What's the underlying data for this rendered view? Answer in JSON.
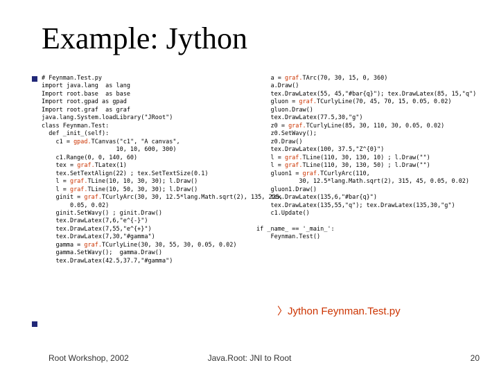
{
  "title": "Example: Jython",
  "code_left": "# Feynman.Test.py\nimport java.lang  as lang\nImport root.base  as base\nImport root.gpad as gpad\nImport root.graf  as graf\njava.lang.System.loadLibrary(\"JRoot\")\nclass Feynman.Test:\n  def _init_(self):\n    c1 = gpad.TCanvas(\"c1\", \"A canvas\",\n                     10, 10, 600, 300)\n    c1.Range(0, 0, 140, 60)\n    tex = graf.TLatex(1)\n    tex.SetTextAlign(22) ; tex.SetTextSize(0.1)\n    l = graf.TLine(10, 10, 30, 30); l.Draw()\n    l = graf.TLine(10, 50, 30, 30); l.Draw()\n    ginit = graf.TCurlyArc(30, 30, 12.5*lang.Math.sqrt(2), 135, 225,\n        0.05, 0.02)\n    ginit.SetWavy() ; ginit.Draw()\n    tex.DrawLatex(7,6,\"e^{-}\")\n    tex.DrawLatex(7,55,\"e^{+}\")\n    tex.DrawLatex(7,30,\"#gamma\")\n    gamma = graf.TCurlyLine(30, 30, 55, 30, 0.05, 0.02)\n    gamma.SetWavy();  gamma.Draw()\n    tex.DrawLatex(42.5,37.7,\"#gamma\")",
  "code_right": "    a = graf.TArc(70, 30, 15, 0, 360)\n    a.Draw()\n    tex.DrawLatex(55, 45,\"#bar{q}\"); tex.DrawLatex(85, 15,\"q\")\n    gluon = graf.TCurlyLine(70, 45, 70, 15, 0.05, 0.02)\n    gluon.Draw()\n    tex.DrawLatex(77.5,30,\"g\")\n    z0 = graf.TCurlyLine(85, 30, 110, 30, 0.05, 0.02)\n    z0.SetWavy();\n    z0.Draw()\n    tex.DrawLatex(100, 37.5,\"Z^{0}\")\n    l = graf.TLine(110, 30, 130, 10) ; l.Draw(\"\")\n    l = graf.TLine(110, 30, 130, 50) ; l.Draw(\"\")\n    gluon1 = graf.TCurlyArc(110,\n            30, 12.5*lang.Math.sqrt(2), 315, 45, 0.05, 0.02)\n    gluon1.Draw()\n    tex.DrawLatex(135,6,\"#bar{q}\")\n    tex.DrawLatex(135,55,\"q\"); tex.DrawLatex(135,30,\"g\")\n    c1.Update()\n\nif _name_ == '_main_':\n    Feynman.Test()",
  "command": "Jython Feynman.Test.py",
  "footer_left": "Root Workshop, 2002",
  "footer_center": "Java.Root: JNI to Root",
  "footer_right": "20"
}
